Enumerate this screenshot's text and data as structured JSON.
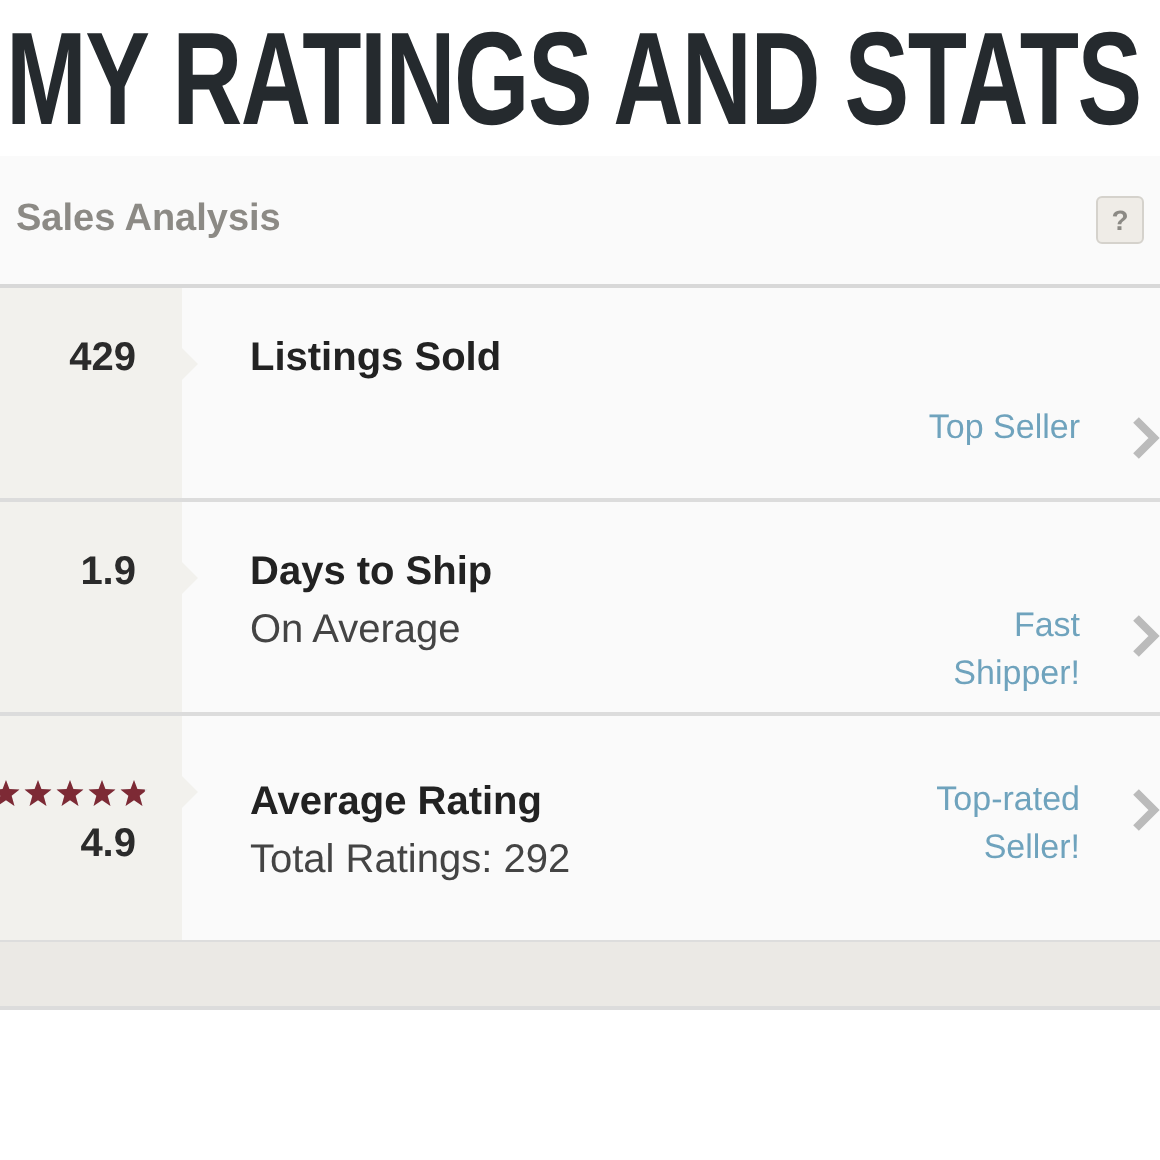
{
  "headline": "MY RATINGS AND STATS",
  "panel": {
    "title": "Sales Analysis",
    "help": "?",
    "rows": [
      {
        "kind": "number",
        "figure": "429",
        "title": "Listings Sold",
        "badge": "Top Seller"
      },
      {
        "kind": "number",
        "figure": "1.9",
        "title": "Days to Ship",
        "subtitle": "On Average",
        "badge": "Fast Shipper!"
      },
      {
        "kind": "rating",
        "stars": 4.9,
        "figure": "4.9",
        "title": "Average Rating",
        "subtitle": "Total Ratings: 292",
        "badge": "Top-rated Seller!"
      }
    ]
  }
}
